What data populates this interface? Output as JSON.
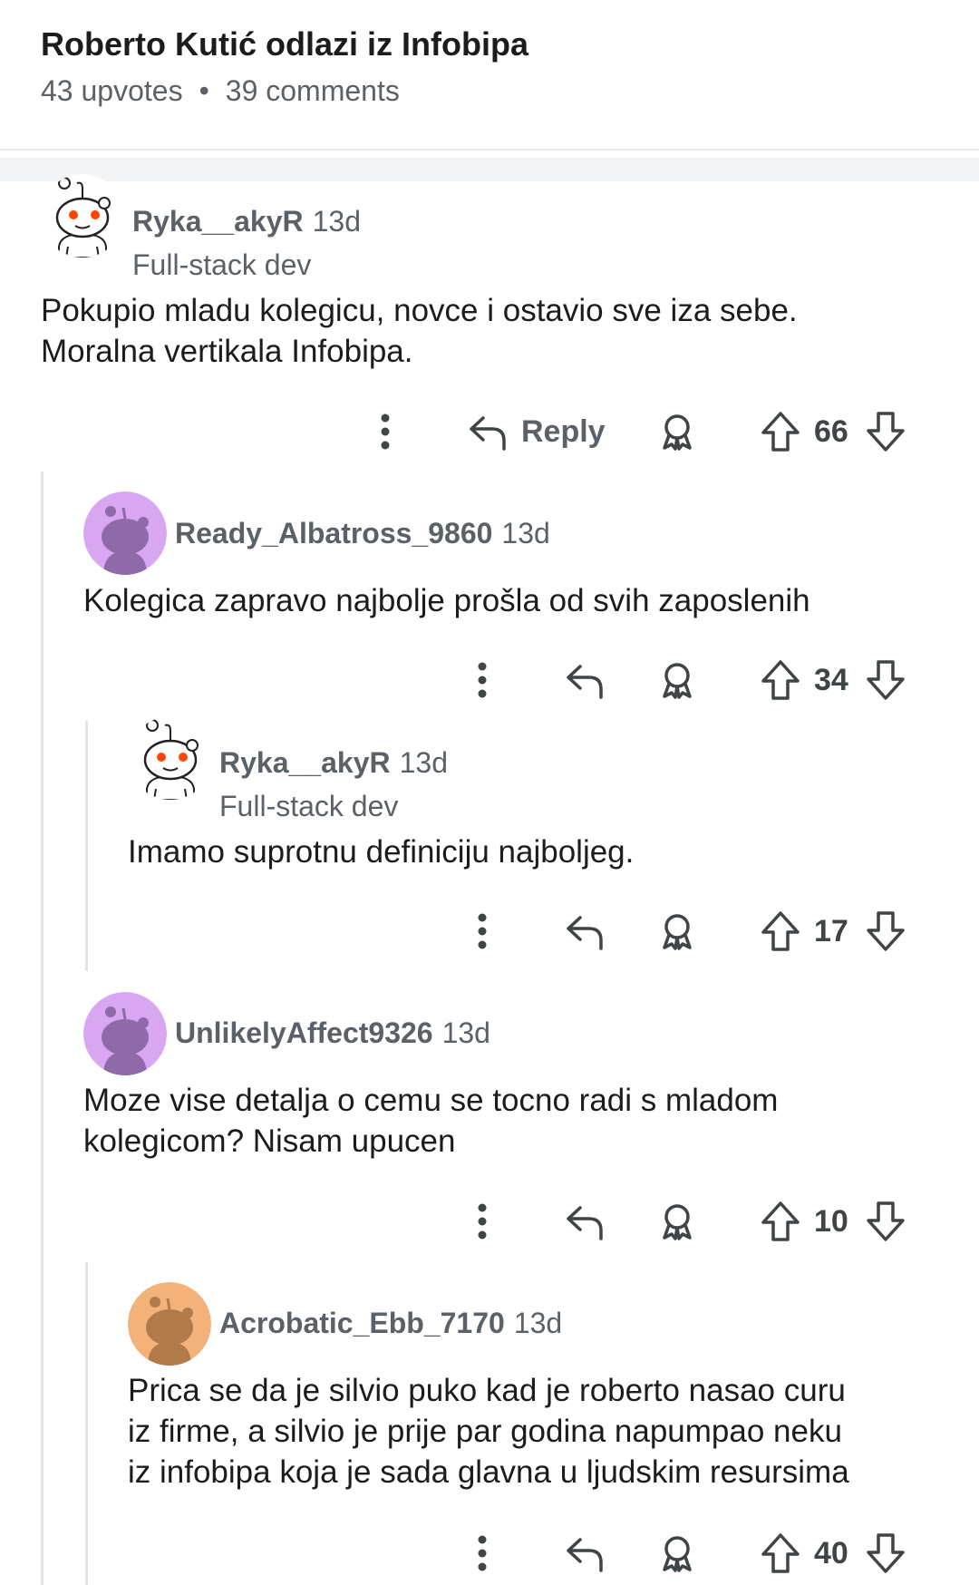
{
  "post": {
    "title": "Roberto Kutić odlazi iz Infobipa",
    "upvotes": "43 upvotes",
    "separator": "•",
    "comments": "39 comments"
  },
  "icons": {
    "more": "more-vertical-icon",
    "reply": "reply-arrow-icon",
    "award": "award-icon",
    "upvote": "upvote-arrow-icon",
    "downvote": "downvote-arrow-icon"
  },
  "colors": {
    "snoo_eye": "#ff4500",
    "purple_avatar": "#d9a6f2",
    "orange_avatar": "#f2b27a",
    "text_secondary": "#5b6168"
  },
  "comments": [
    {
      "username": "Ryka__akyR",
      "age": "13d",
      "flair": "Full-stack dev",
      "body": [
        "Pokupio mladu kolegicu, novce i ostavio sve iza sebe.",
        "Moralna vertikala Infobipa."
      ],
      "reply_label": "Reply",
      "votes": "66"
    },
    {
      "username": "Ready_Albatross_9860",
      "age": "13d",
      "body": [
        "Kolegica zapravo najbolje prošla od svih zaposlenih"
      ],
      "votes": "34"
    },
    {
      "username": "Ryka__akyR",
      "age": "13d",
      "flair": "Full-stack dev",
      "body": [
        "Imamo suprotnu definiciju najboljeg."
      ],
      "votes": "17"
    },
    {
      "username": "UnlikelyAffect9326",
      "age": "13d",
      "body": [
        "Moze vise detalja o cemu se tocno radi s mladom",
        "kolegicom? Nisam upucen"
      ],
      "votes": "10"
    },
    {
      "username": "Acrobatic_Ebb_7170",
      "age": "13d",
      "body": [
        "Prica se da je silvio puko kad je roberto nasao curu",
        "iz firme, a silvio je prije par godina napumpao neku",
        "iz infobipa koja je sada glavna u ljudskim resursima"
      ],
      "votes": "40"
    }
  ]
}
